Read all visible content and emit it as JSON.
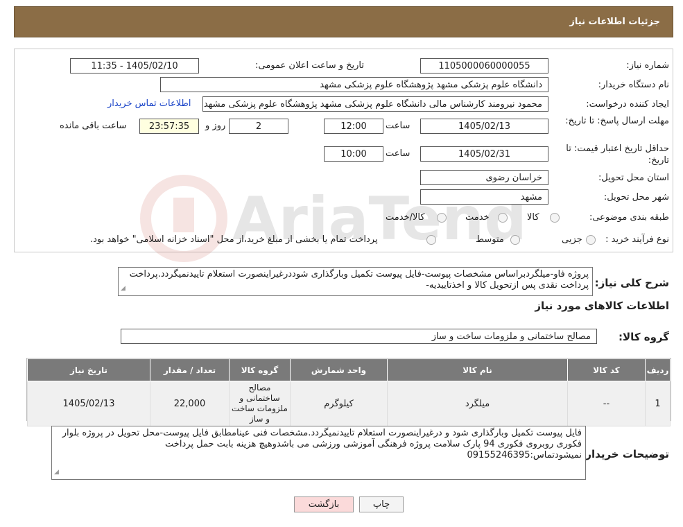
{
  "header": {
    "title": "جزئیات اطلاعات نیاز"
  },
  "form": {
    "need_number_label": "شماره نیاز:",
    "need_number": "1105000060000055",
    "announce_label": "تاریخ و ساعت اعلان عمومی:",
    "announce_value": "1405/02/10 - 11:35",
    "buyer_org_label": "نام دستگاه خریدار:",
    "buyer_org": "دانشگاه علوم پزشکی مشهد   پژوهشگاه علوم پزشکی مشهد",
    "creator_label": "ایجاد کننده درخواست:",
    "creator": "محمود نیرومند کارشناس مالی دانشگاه علوم پزشکی مشهد   پژوهشگاه علوم پزشکی مشهد",
    "contact_link": "اطلاعات تماس خریدار",
    "deadline_label": "مهلت ارسال پاسخ: تا تاریخ:",
    "deadline_date": "1405/02/13",
    "time_label": "ساعت",
    "deadline_time": "12:00",
    "days_value": "2",
    "days_label": "روز و",
    "remaining_time": "23:57:35",
    "remaining_label": "ساعت باقی مانده",
    "validity_label": "حداقل تاریخ اعتبار قیمت: تا تاریخ:",
    "validity_date": "1405/02/31",
    "validity_time": "10:00",
    "province_label": "استان محل تحویل:",
    "province": "خراسان رضوی",
    "city_label": "شهر محل تحویل:",
    "city": "مشهد",
    "category_label": "طبقه بندی موضوعی:",
    "category_options": [
      "کالا",
      "خدمت",
      "کالا/خدمت"
    ],
    "process_label": "نوع فرآیند خرید :",
    "process_options": [
      "جزیی",
      "متوسط"
    ],
    "process_note": "پرداخت تمام یا بخشی از مبلغ خرید،از محل \"اسناد خزانه اسلامی\" خواهد بود."
  },
  "summary": {
    "label": "شرح کلی نیاز:",
    "text": "پروژه فاو-میلگردبراساس مشخصات پیوست-فایل پیوست تکمیل وبارگذاری شوددرغیراینصورت استعلام تاییدنمیگردد.پرداخت پرداخت نقدی پس ازتحویل کالا و اخذتاییدیه-"
  },
  "goods": {
    "section_title": "اطلاعات کالاهای مورد نیاز",
    "group_label": "گروه کالا:",
    "group_value": "مصالح ساختمانی و ملزومات ساخت و ساز",
    "columns": [
      "ردیف",
      "کد کالا",
      "نام کالا",
      "واحد شمارش",
      "گروه کالا",
      "تعداد / مقدار",
      "تاریخ نیاز"
    ],
    "rows": [
      [
        "1",
        "--",
        "میلگرد",
        "کیلوگرم",
        "مصالح ساختمانی و ملزومات ساخت و ساز",
        "22,000",
        "1405/02/13"
      ]
    ]
  },
  "buyer_notes": {
    "label": "توضیحات خریدار:",
    "text": "فایل پیوست تکمیل وبارگذاری شود و درغیراینصورت استعلام تاییدنمیگردد.مشخصات فنی عینامطابق فایل پیوست-محل تحویل در پروژه بلوار فکوری روبروی فکوری 94 پارک سلامت پروژه فرهنگی آموزشی ورزشی می باشدوهیچ هزینه بابت حمل پرداخت نمیشودتماس:09155246395"
  },
  "buttons": {
    "print": "چاپ",
    "back": "بازگشت"
  },
  "colors": {
    "header_bg": "#8b6d46",
    "table_header": "#7a7a7a",
    "back_button": "#fbdada",
    "link": "#1a44c8"
  }
}
